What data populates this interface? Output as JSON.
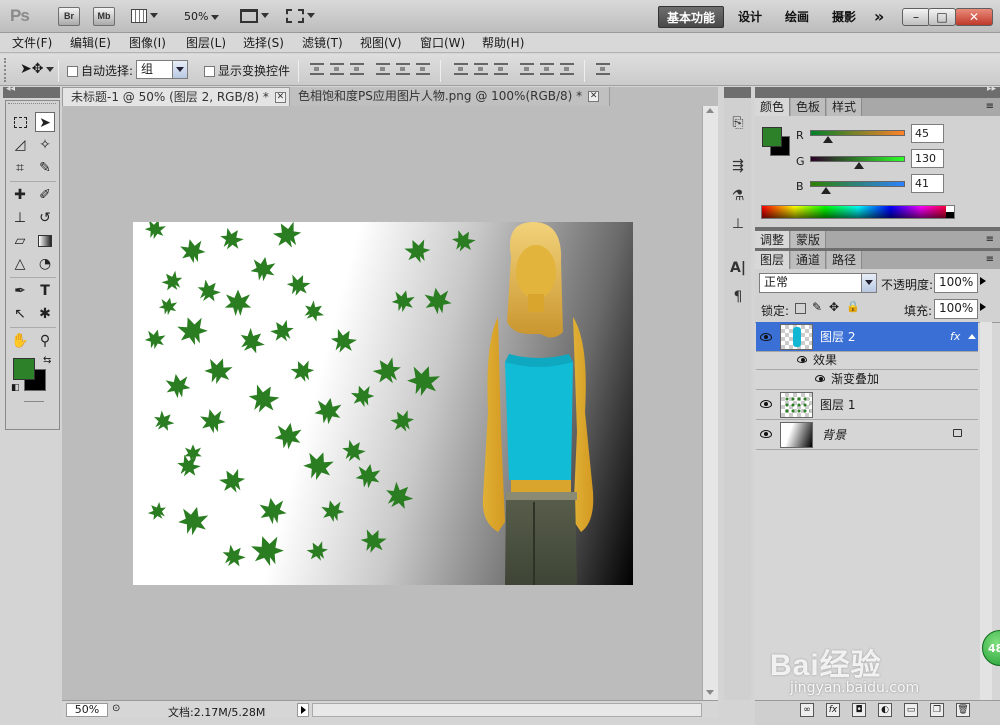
{
  "app": {
    "logo": "Ps",
    "bridge_button": "Br",
    "minibridge_button": "Mb",
    "zoom_level": "50%",
    "workspaces": [
      "基本功能",
      "设计",
      "绘画",
      "摄影"
    ],
    "more_symbol": "»",
    "window_buttons": [
      "–",
      "□",
      "✕"
    ]
  },
  "menu": [
    "文件(F)",
    "编辑(E)",
    "图像(I)",
    "图层(L)",
    "选择(S)",
    "滤镜(T)",
    "视图(V)",
    "窗口(W)",
    "帮助(H)"
  ],
  "options": {
    "auto_select_label": "自动选择:",
    "auto_select_value": "组",
    "show_transform_label": "显示变换控件"
  },
  "documents": {
    "tabs": [
      {
        "label": "未标题-1 @ 50% (图层 2, RGB/8) *",
        "active": true
      },
      {
        "label": "色相饱和度PS应用图片人物.png @ 100%(RGB/8) *",
        "active": false
      }
    ],
    "close_symbol": "✕"
  },
  "status": {
    "zoom": "50%",
    "doc_info": "文档:2.17M/5.28M"
  },
  "color_panel": {
    "tabs": [
      "颜色",
      "色板",
      "样式"
    ],
    "channels": [
      {
        "label": "R",
        "value": "45"
      },
      {
        "label": "G",
        "value": "130"
      },
      {
        "label": "B",
        "value": "41"
      }
    ],
    "levels": [
      0.176,
      0.51,
      0.161
    ],
    "foreground": "#2d8229",
    "background": "#000000"
  },
  "adjust_panel": {
    "tabs": [
      "调整",
      "蒙版"
    ]
  },
  "layers_panel": {
    "tabs": [
      "图层",
      "通道",
      "路径"
    ],
    "blend_mode": "正常",
    "opacity_label": "不透明度:",
    "opacity_value": "100%",
    "lock_label": "锁定:",
    "fill_label": "填充:",
    "fill_value": "100%",
    "layers": [
      {
        "name": "图层 2",
        "selected": true,
        "fx": "fx"
      },
      {
        "name": "效果"
      },
      {
        "name": "渐变叠加"
      },
      {
        "name": "图层 1"
      },
      {
        "name": "背景",
        "locked": true
      }
    ]
  },
  "watermark": {
    "text": "Bai经验",
    "url": "jingyan.baidu.com",
    "badge": "48"
  }
}
